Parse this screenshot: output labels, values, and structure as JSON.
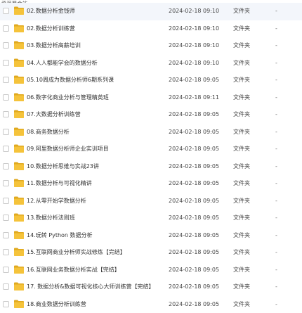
{
  "watermark": "资源聚合站",
  "type_label": "文件夹",
  "size_placeholder": "-",
  "folder_color": "#f5c33b",
  "files": [
    {
      "name": "02.数据分析金钱师",
      "date": "2024-02-18 09:10"
    },
    {
      "name": "02.数据分析训练营",
      "date": "2024-02-18 09:10"
    },
    {
      "name": "03.数据分析高薪培训",
      "date": "2024-02-18 09:10"
    },
    {
      "name": "04.人人都能学会的数据分析",
      "date": "2024-02-18 09:10"
    },
    {
      "name": "05.10周成为数据分析师6期系列课",
      "date": "2024-02-18 09:05"
    },
    {
      "name": "06.数字化商业分析与管理精英班",
      "date": "2024-02-18 09:11"
    },
    {
      "name": "07.大数据分析训练营",
      "date": "2024-02-18 09:05"
    },
    {
      "name": "08.商务数据分析",
      "date": "2024-02-18 09:05"
    },
    {
      "name": "09.阿里数据分析师企业实训项目",
      "date": "2024-02-18 09:05"
    },
    {
      "name": "10.数据分析思维与实战23讲",
      "date": "2024-02-18 09:05"
    },
    {
      "name": "11.数据分析与可视化精讲",
      "date": "2024-02-18 09:05"
    },
    {
      "name": "12.从零开始学数据分析",
      "date": "2024-02-18 09:05"
    },
    {
      "name": "13.数据分析法则班",
      "date": "2024-02-18 09:05"
    },
    {
      "name": "14.玩转 Python 数据分析",
      "date": "2024-02-18 09:05"
    },
    {
      "name": "15.互联网商业分析师实战修炼【完结】",
      "date": "2024-02-18 09:05"
    },
    {
      "name": "16.互联网业务数据分析实战【完结】",
      "date": "2024-02-18 09:05"
    },
    {
      "name": "17. 数据分析&数据可视化核心大师训练营【完结】",
      "date": "2024-02-18 09:05"
    },
    {
      "name": "18.商业数据分析训练营",
      "date": "2024-02-18 09:05"
    }
  ]
}
